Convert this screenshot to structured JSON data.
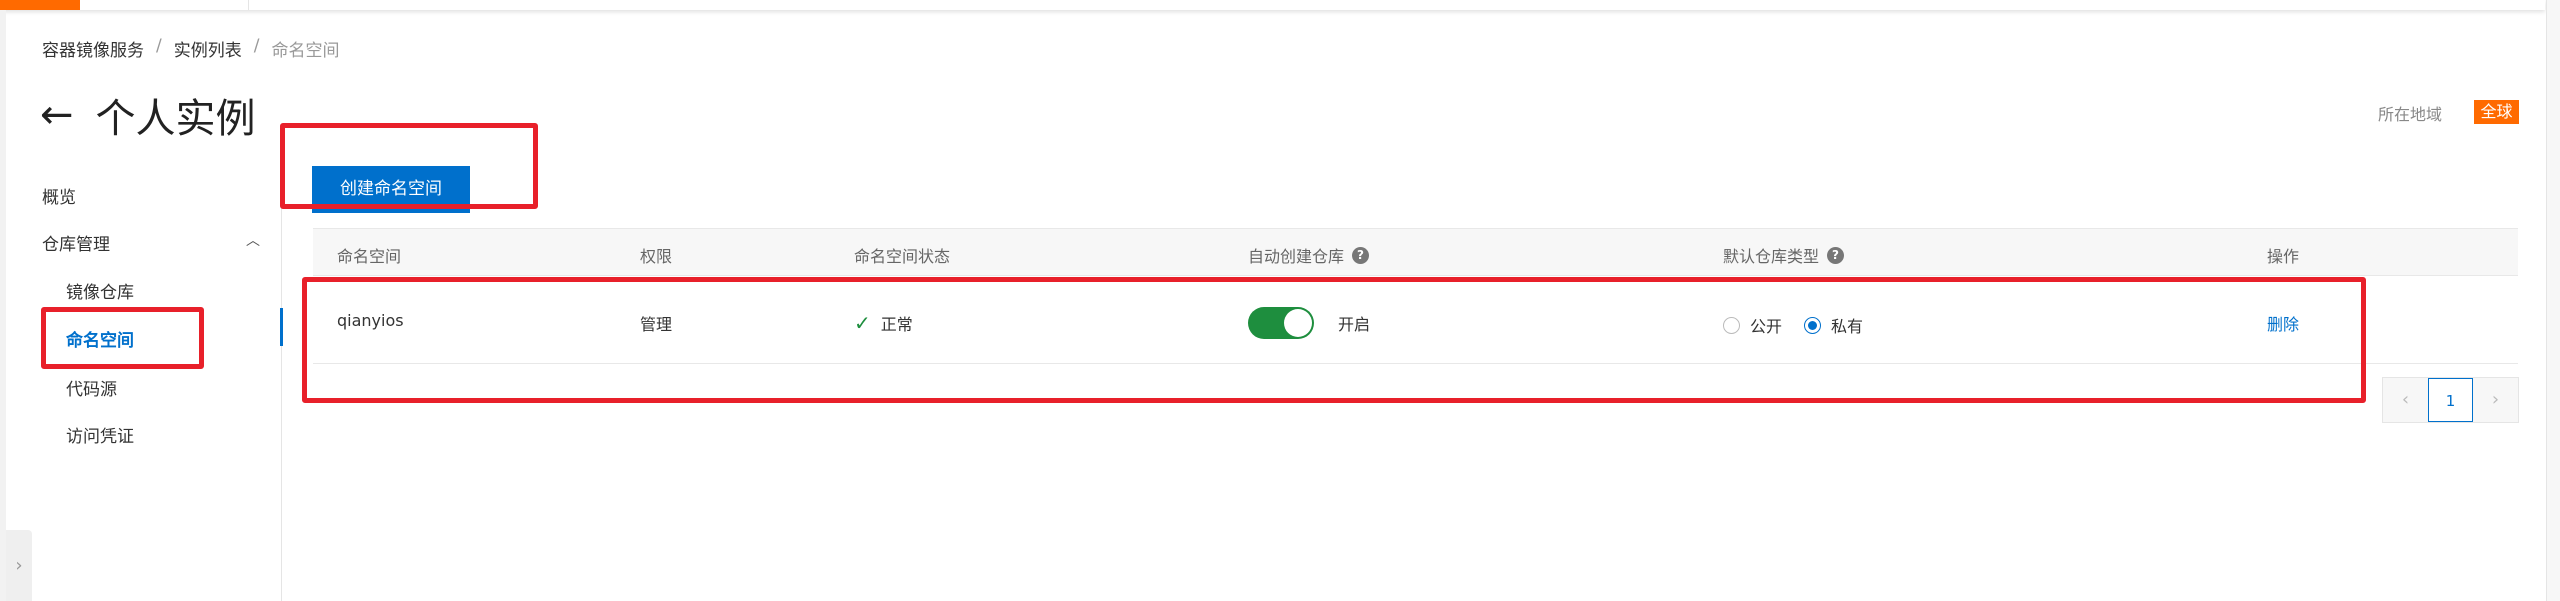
{
  "breadcrumb": [
    "容器镜像服务",
    "实例列表",
    "命名空间"
  ],
  "header": {
    "title": "个人实例",
    "region_label": "所在地域",
    "region_value": "全球"
  },
  "sidebar": {
    "items": [
      {
        "label": "概览"
      },
      {
        "label": "仓库管理"
      },
      {
        "label": "镜像仓库"
      },
      {
        "label": "命名空间"
      },
      {
        "label": "代码源"
      },
      {
        "label": "访问凭证"
      }
    ],
    "active": "命名空间"
  },
  "toolbar": {
    "create_label": "创建命名空间"
  },
  "table": {
    "columns": [
      "命名空间",
      "权限",
      "命名空间状态",
      "自动创建仓库",
      "默认仓库类型",
      "操作"
    ],
    "rows": [
      {
        "namespace": "qianyios",
        "permission": "管理",
        "status": "正常",
        "auto_create": "开启",
        "auto_create_on": true,
        "repo_type_options": [
          "公开",
          "私有"
        ],
        "repo_type_selected": "私有",
        "action": "删除"
      }
    ]
  },
  "pagination": {
    "current": "1"
  },
  "colors": {
    "accent": "#0070cc",
    "brand": "#ff6a00",
    "success": "#1e8e3e",
    "annotation": "#e8202a"
  }
}
